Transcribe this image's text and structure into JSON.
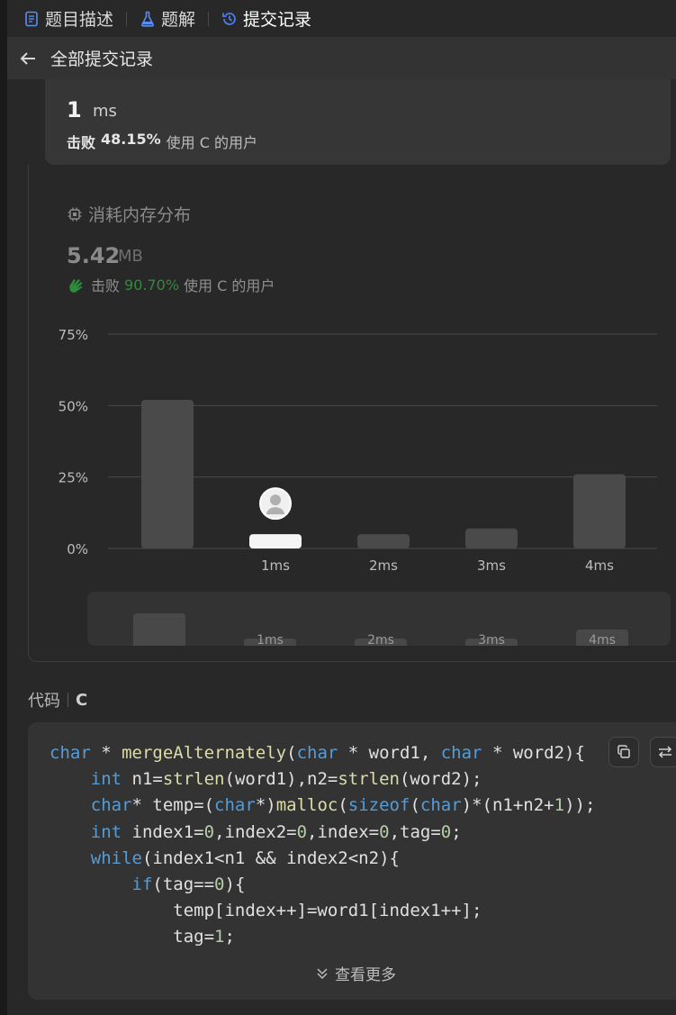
{
  "tabs": [
    {
      "label": "题目描述",
      "icon": "document-icon"
    },
    {
      "label": "题解",
      "icon": "flask-icon"
    },
    {
      "label": "提交记录",
      "icon": "history-icon"
    }
  ],
  "subheader": {
    "title": "全部提交记录"
  },
  "runtime": {
    "value": "1",
    "unit": "ms",
    "beat_label": "击败",
    "beat_pct": "48.15%",
    "beat_suffix": "使用 C 的用户"
  },
  "memory": {
    "title": "消耗内存分布",
    "value": "5.42",
    "unit": "MB",
    "beat_label": "击败",
    "beat_pct": "90.70%",
    "beat_suffix": "使用 C 的用户"
  },
  "colors": {
    "accent_green": "#2e8b3c",
    "active_tab_icon": "#4a7cf0"
  },
  "chart_data": {
    "type": "bar",
    "categories": [
      "",
      "1ms",
      "2ms",
      "3ms",
      "4ms"
    ],
    "values": [
      52,
      5,
      5,
      7,
      26
    ],
    "yticks": [
      "75%",
      "50%",
      "25%",
      "0%"
    ],
    "ytick_values": [
      75,
      50,
      25,
      0
    ],
    "ylim": [
      0,
      75
    ],
    "highlight_index": 1,
    "grid": true
  },
  "code_section": {
    "label": "代码",
    "lang": "C",
    "more": "查看更多"
  }
}
